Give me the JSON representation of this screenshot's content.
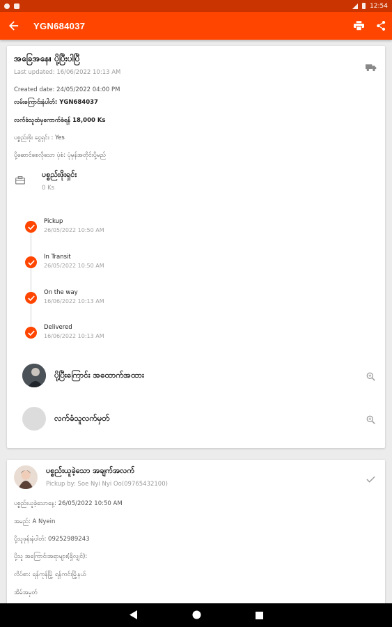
{
  "status_bar": {
    "time": "12:54"
  },
  "app_bar": {
    "title": "YGN684037",
    "back_icon": "arrow-left-icon",
    "print_icon": "printer-icon",
    "share_icon": "share-icon"
  },
  "detail_card": {
    "title": "အခြေအနေ။ ပို့ပြီးပါပြီ",
    "last_updated": "Last updated: 16/06/2022 10:13 AM",
    "created_date": "Created date: 24/05/2022 04:00 PM",
    "tracking_number": "လမ်းကြောင်းနံပါတ်: YGN684037",
    "receiver_charge": "လက်ခံသူထံမှကောက်ခံရန် 18,000 Ks",
    "paid_by_sender": "ပစ္စည်းဖိုး ငွေရှင်း : Yes",
    "delivery_type": "ပို့ဆောင်စေလိုသော ပုံစံ: ပုံမှန်အတိုင်းပို့မည်",
    "package_title": "ပစ္စည်းဖိုးရှင်း",
    "package_amount": "0 Ks",
    "timeline": [
      {
        "label": "Pickup",
        "date": "26/05/2022 10:50 AM"
      },
      {
        "label": "In Transit",
        "date": "26/05/2022 10:50 AM"
      },
      {
        "label": "On the way",
        "date": "16/06/2022 10:13 AM"
      },
      {
        "label": "Delivered",
        "date": "16/06/2022 10:13 AM"
      }
    ],
    "route_info_label": "ပို့ပြီးကြောင်း အထောက်အထား",
    "receiver_signature_label": "လက်ခံသူလက်မှတ်"
  },
  "pickup_card": {
    "title": "ပစ္စည်းယူခဲ့သော အချက်အလက်",
    "pickup_by": "Pickup by: Soe Nyi Nyi Oo(09765432100)",
    "pickup_date": "ပစ္စည်းယူခဲ့သောနေ့: 26/05/2022 10:50 AM",
    "name": "အမည်: A Nyein",
    "phone": "ပို့သူဖုန်းနံပါတ်: 09252989243",
    "address_heading": "ပို့သူ အကြောင်းအရာများ(ရှိလျှင်):",
    "address": "လိပ်စာ: ရန်ကုန်မြို့ ရန်ကင်းမြို့နယ်",
    "note": "အိမ်အမှတ်"
  }
}
